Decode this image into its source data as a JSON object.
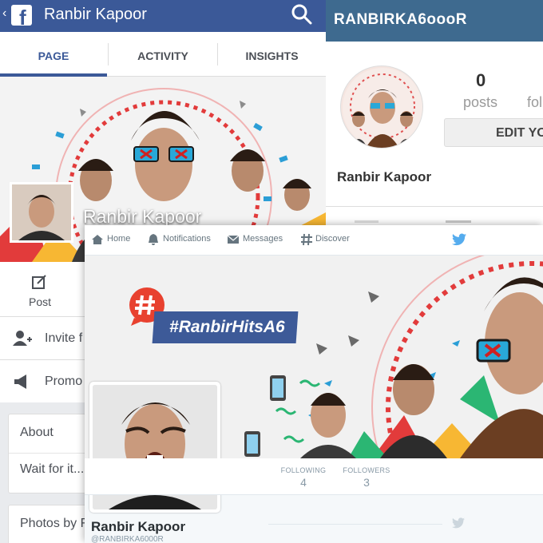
{
  "instagram": {
    "username": "RANBIRKA6oooR",
    "posts_count": "0",
    "posts_label": "posts",
    "followers_label_partial": "fol",
    "edit_button": "EDIT YO",
    "display_name": "Ranbir Kapoor"
  },
  "facebook": {
    "page_title": "Ranbir Kapoor",
    "tabs": [
      {
        "label": "PAGE",
        "active": true
      },
      {
        "label": "ACTIVITY",
        "active": false
      },
      {
        "label": "INSIGHTS",
        "active": false
      }
    ],
    "cover_name": "Ranbir Kapoor",
    "post_label": "Post",
    "rows": [
      {
        "label": "Invite f",
        "icon": "add-friend-icon"
      },
      {
        "label": "Promo",
        "icon": "megaphone-icon"
      }
    ],
    "about_card": {
      "heading": "About",
      "body": "Wait for it..."
    },
    "photos_card": {
      "heading": "Photos by F"
    },
    "accent": "#3b5998"
  },
  "twitter": {
    "nav": [
      {
        "label": "Home",
        "icon": "home-icon"
      },
      {
        "label": "Notifications",
        "icon": "bell-icon"
      },
      {
        "label": "Messages",
        "icon": "envelope-icon"
      },
      {
        "label": "Discover",
        "icon": "hash-icon"
      }
    ],
    "hashtag": "RanbirHitsA6",
    "stats": [
      {
        "label": "FOLLOWING",
        "value": "4"
      },
      {
        "label": "FOLLOWERS",
        "value": "3"
      }
    ],
    "display_name": "Ranbir Kapoor",
    "handle": "@RANBIRKA6000R",
    "accent": "#55acee"
  }
}
